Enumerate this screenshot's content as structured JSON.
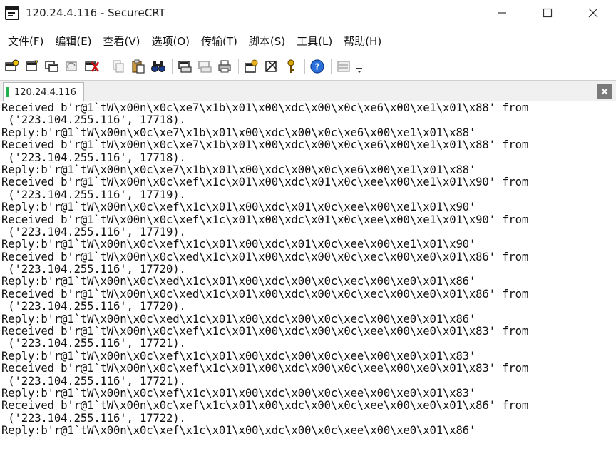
{
  "window": {
    "title": "120.24.4.116 - SecureCRT"
  },
  "menu": {
    "items": [
      "文件(F)",
      "编辑(E)",
      "查看(V)",
      "选项(O)",
      "传输(T)",
      "脚本(S)",
      "工具(L)",
      "帮助(H)"
    ]
  },
  "toolbar": {
    "buttons": [
      "connect-icon",
      "quick-connect-icon",
      "connect-in-tab-icon",
      "reconnect-icon",
      "disconnect-icon",
      "copy-icon",
      "paste-icon",
      "find-icon",
      "print-icon",
      "print-selection-icon",
      "printer-icon",
      "session-options-icon",
      "global-options-icon",
      "key-icon",
      "help-icon",
      "keymap-icon"
    ]
  },
  "tabs": [
    {
      "label": "120.24.4.116",
      "status_color": "#22b14c"
    }
  ],
  "terminal": {
    "lines": [
      "Received b'r@1`tW\\x00n\\x0c\\xe7\\x1b\\x01\\x00\\xdc\\x00\\x0c\\xe6\\x00\\xe1\\x01\\x88' from",
      " ('223.104.255.116', 17718).",
      "Reply:b'r@1`tW\\x00n\\x0c\\xe7\\x1b\\x01\\x00\\xdc\\x00\\x0c\\xe6\\x00\\xe1\\x01\\x88'",
      "Received b'r@1`tW\\x00n\\x0c\\xe7\\x1b\\x01\\x00\\xdc\\x00\\x0c\\xe6\\x00\\xe1\\x01\\x88' from",
      " ('223.104.255.116', 17718).",
      "Reply:b'r@1`tW\\x00n\\x0c\\xe7\\x1b\\x01\\x00\\xdc\\x00\\x0c\\xe6\\x00\\xe1\\x01\\x88'",
      "Received b'r@1`tW\\x00n\\x0c\\xef\\x1c\\x01\\x00\\xdc\\x01\\x0c\\xee\\x00\\xe1\\x01\\x90' from",
      " ('223.104.255.116', 17719).",
      "Reply:b'r@1`tW\\x00n\\x0c\\xef\\x1c\\x01\\x00\\xdc\\x01\\x0c\\xee\\x00\\xe1\\x01\\x90'",
      "Received b'r@1`tW\\x00n\\x0c\\xef\\x1c\\x01\\x00\\xdc\\x01\\x0c\\xee\\x00\\xe1\\x01\\x90' from",
      " ('223.104.255.116', 17719).",
      "Reply:b'r@1`tW\\x00n\\x0c\\xef\\x1c\\x01\\x00\\xdc\\x01\\x0c\\xee\\x00\\xe1\\x01\\x90'",
      "Received b'r@1`tW\\x00n\\x0c\\xed\\x1c\\x01\\x00\\xdc\\x00\\x0c\\xec\\x00\\xe0\\x01\\x86' from",
      " ('223.104.255.116', 17720).",
      "Reply:b'r@1`tW\\x00n\\x0c\\xed\\x1c\\x01\\x00\\xdc\\x00\\x0c\\xec\\x00\\xe0\\x01\\x86'",
      "Received b'r@1`tW\\x00n\\x0c\\xed\\x1c\\x01\\x00\\xdc\\x00\\x0c\\xec\\x00\\xe0\\x01\\x86' from",
      " ('223.104.255.116', 17720).",
      "Reply:b'r@1`tW\\x00n\\x0c\\xed\\x1c\\x01\\x00\\xdc\\x00\\x0c\\xec\\x00\\xe0\\x01\\x86'",
      "Received b'r@1`tW\\x00n\\x0c\\xef\\x1c\\x01\\x00\\xdc\\x00\\x0c\\xee\\x00\\xe0\\x01\\x83' from",
      " ('223.104.255.116', 17721).",
      "Reply:b'r@1`tW\\x00n\\x0c\\xef\\x1c\\x01\\x00\\xdc\\x00\\x0c\\xee\\x00\\xe0\\x01\\x83'",
      "Received b'r@1`tW\\x00n\\x0c\\xef\\x1c\\x01\\x00\\xdc\\x00\\x0c\\xee\\x00\\xe0\\x01\\x83' from",
      " ('223.104.255.116', 17721).",
      "Reply:b'r@1`tW\\x00n\\x0c\\xef\\x1c\\x01\\x00\\xdc\\x00\\x0c\\xee\\x00\\xe0\\x01\\x83'",
      "Received b'r@1`tW\\x00n\\x0c\\xef\\x1c\\x01\\x00\\xdc\\x00\\x0c\\xee\\x00\\xe0\\x01\\x86' from",
      " ('223.104.255.116', 17722).",
      "Reply:b'r@1`tW\\x00n\\x0c\\xef\\x1c\\x01\\x00\\xdc\\x00\\x0c\\xee\\x00\\xe0\\x01\\x86'"
    ]
  }
}
